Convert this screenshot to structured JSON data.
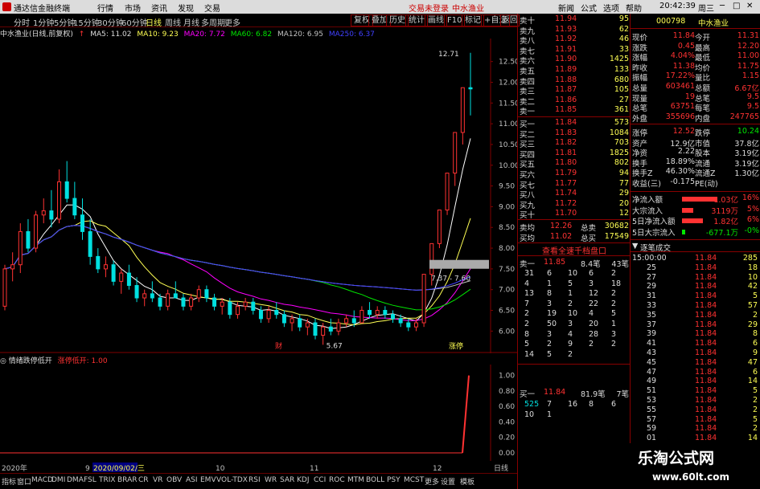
{
  "app": {
    "title": "通达信金融终端",
    "tabs": [
      "行情",
      "市场",
      "资讯",
      "发现",
      "交易"
    ],
    "login": "交易未登录",
    "stock_name": "中水渔业",
    "right_menu": [
      "新闻",
      "公式",
      "选项",
      "帮助"
    ],
    "time": "20:42:39",
    "weekday": "周三"
  },
  "toolbar": {
    "periods": [
      "分时",
      "1分钟",
      "5分钟",
      "15分钟",
      "30分钟",
      "60分钟",
      "日线",
      "周线",
      "月线",
      "多周期",
      "更多"
    ],
    "active_period": "日线",
    "buttons": [
      "复权",
      "叠加",
      "历史",
      "统计",
      "画线",
      "F10",
      "标记",
      "+自选",
      "返回"
    ]
  },
  "infobar": {
    "name": "中水渔业(日线,前复权)",
    "ma5": "MA5: 11.02",
    "ma10": "MA10: 9.23",
    "ma20": "MA20: 7.72",
    "ma60": "MA60: 6.82",
    "ma120": "MA120: 6.95",
    "ma250": "MA250: 6.37"
  },
  "colors": {
    "up": "#ff3232",
    "down": "#00e0e0",
    "ma5": "#ffffff",
    "ma10": "#ffff54",
    "ma20": "#ff00ff",
    "ma60": "#00e600",
    "ma120": "#c0c0c0",
    "ma250": "#4040ff",
    "grid": "#800000"
  },
  "chart_data": {
    "type": "candlestick",
    "y_ticks": [
      "12.50",
      "12.00",
      "11.50",
      "11.00",
      "10.50",
      "10.00",
      "9.50",
      "9.00",
      "8.50",
      "8.00",
      "7.50",
      "7.00",
      "6.50",
      "6.00"
    ],
    "ylim": [
      5.6,
      12.9
    ],
    "annotations": {
      "high": "12.71",
      "low": "5.67",
      "range_box": "7.37 - 7.60",
      "event1": "财",
      "event2": "涨停"
    },
    "candles": [
      [
        6.6,
        7.6,
        6.5,
        7.5
      ],
      [
        7.5,
        7.9,
        7.2,
        7.6
      ],
      [
        7.6,
        8.6,
        7.4,
        8.4
      ],
      [
        8.4,
        8.7,
        7.9,
        8.0
      ],
      [
        8.0,
        8.9,
        7.9,
        8.8
      ],
      [
        8.8,
        9.2,
        8.6,
        8.9
      ],
      [
        8.9,
        9.4,
        8.5,
        8.7
      ],
      [
        8.7,
        9.9,
        8.6,
        9.6
      ],
      [
        9.6,
        10.1,
        9.1,
        9.2
      ],
      [
        9.2,
        9.6,
        8.7,
        8.8
      ],
      [
        8.8,
        9.2,
        8.2,
        8.4
      ],
      [
        8.4,
        8.7,
        7.6,
        7.8
      ],
      [
        7.8,
        8.0,
        7.4,
        7.5
      ],
      [
        7.5,
        7.8,
        7.3,
        7.6
      ],
      [
        7.6,
        7.7,
        7.1,
        7.2
      ],
      [
        7.2,
        7.5,
        6.9,
        7.4
      ],
      [
        7.4,
        7.6,
        7.0,
        7.1
      ],
      [
        7.1,
        7.3,
        6.7,
        6.8
      ],
      [
        6.8,
        7.0,
        6.6,
        6.9
      ],
      [
        6.9,
        7.2,
        6.7,
        6.8
      ],
      [
        6.8,
        6.9,
        6.5,
        6.6
      ],
      [
        6.6,
        7.0,
        6.5,
        6.9
      ],
      [
        6.9,
        7.2,
        6.8,
        6.8
      ],
      [
        6.8,
        6.9,
        6.5,
        6.6
      ],
      [
        6.6,
        6.9,
        6.5,
        6.8
      ],
      [
        6.8,
        7.1,
        6.7,
        7.0
      ],
      [
        7.0,
        7.1,
        6.7,
        6.8
      ],
      [
        6.8,
        6.9,
        6.5,
        6.6
      ],
      [
        6.6,
        6.8,
        6.4,
        6.7
      ],
      [
        6.7,
        6.8,
        6.3,
        6.4
      ],
      [
        6.4,
        6.7,
        6.3,
        6.6
      ],
      [
        6.6,
        6.8,
        6.5,
        6.7
      ],
      [
        6.7,
        6.8,
        6.4,
        6.5
      ],
      [
        6.5,
        6.6,
        6.2,
        6.3
      ],
      [
        6.3,
        6.6,
        6.2,
        6.5
      ],
      [
        6.5,
        6.7,
        6.3,
        6.4
      ],
      [
        6.4,
        6.5,
        6.1,
        6.2
      ],
      [
        6.2,
        6.4,
        6.0,
        6.3
      ],
      [
        6.3,
        6.4,
        6.0,
        6.1
      ],
      [
        6.1,
        6.3,
        5.9,
        6.2
      ],
      [
        6.2,
        6.3,
        5.8,
        5.9
      ],
      [
        5.9,
        6.2,
        5.67,
        6.1
      ],
      [
        6.1,
        6.3,
        5.9,
        6.0
      ],
      [
        6.0,
        6.3,
        5.9,
        6.2
      ],
      [
        6.2,
        6.4,
        6.1,
        6.3
      ],
      [
        6.3,
        6.5,
        6.1,
        6.2
      ],
      [
        6.2,
        6.6,
        6.2,
        6.5
      ],
      [
        6.5,
        6.7,
        6.3,
        6.4
      ],
      [
        6.4,
        6.6,
        6.3,
        6.5
      ],
      [
        6.5,
        6.6,
        6.3,
        6.4
      ],
      [
        6.4,
        6.5,
        6.2,
        6.3
      ],
      [
        6.3,
        6.4,
        6.1,
        6.2
      ],
      [
        6.2,
        6.3,
        6.0,
        6.1
      ],
      [
        6.1,
        6.3,
        6.0,
        6.2
      ],
      [
        6.2,
        7.37,
        6.1,
        7.37
      ],
      [
        7.37,
        8.11,
        7.1,
        8.11
      ],
      [
        8.11,
        8.92,
        8.0,
        8.92
      ],
      [
        8.92,
        9.81,
        8.8,
        9.81
      ],
      [
        9.81,
        10.79,
        9.5,
        10.79
      ],
      [
        10.79,
        11.87,
        10.5,
        11.87
      ],
      [
        11.87,
        12.71,
        11.2,
        11.84
      ]
    ],
    "indicator": {
      "title": "情绪跌停低开",
      "label": "涨停低开: 1.00",
      "y_ticks": [
        "1.00",
        "0.80",
        "0.60",
        "0.40",
        "0.20",
        "0.00"
      ],
      "ylim": [
        0,
        1.1
      ],
      "values_last": 1.0
    },
    "dates": {
      "start": "2020年",
      "month9": "9",
      "date": "2020/09/02/三",
      "month10": "10",
      "month11": "11",
      "month12": "12"
    }
  },
  "bottomtabs": [
    "指标",
    "窗口",
    "MACD",
    "DMI",
    "DMA",
    "FSL",
    "TRIX",
    "BRAR",
    "CR",
    "VR",
    "OBV",
    "ASI",
    "EMV",
    "VOL-TDX",
    "RSI",
    "WR",
    "SAR",
    "KDJ",
    "CCI",
    "ROC",
    "MTM",
    "BOLL",
    "PSY",
    "MCST",
    "更多",
    "设置",
    "模板"
  ],
  "order_book": {
    "sell": [
      [
        "卖十",
        "11.94",
        "95"
      ],
      [
        "卖九",
        "11.93",
        "62"
      ],
      [
        "卖八",
        "11.92",
        "46"
      ],
      [
        "卖七",
        "11.91",
        "33"
      ],
      [
        "卖六",
        "11.90",
        "1425"
      ],
      [
        "卖五",
        "11.89",
        "133"
      ],
      [
        "卖四",
        "11.88",
        "680"
      ],
      [
        "卖三",
        "11.87",
        "105"
      ],
      [
        "卖二",
        "11.86",
        "27"
      ],
      [
        "卖一",
        "11.85",
        "361"
      ]
    ],
    "buy": [
      [
        "买一",
        "11.84",
        "573"
      ],
      [
        "买二",
        "11.83",
        "1084"
      ],
      [
        "买三",
        "11.82",
        "703"
      ],
      [
        "买四",
        "11.81",
        "1825"
      ],
      [
        "买五",
        "11.80",
        "802"
      ],
      [
        "买六",
        "11.79",
        "94"
      ],
      [
        "买七",
        "11.77",
        "77"
      ],
      [
        "买八",
        "11.74",
        "29"
      ],
      [
        "买九",
        "11.72",
        "20"
      ],
      [
        "买十",
        "11.70",
        "12"
      ]
    ],
    "avg_sell": [
      "卖均",
      "12.26",
      "总卖",
      "30682"
    ],
    "avg_buy": [
      "买均",
      "11.02",
      "总买",
      "17549"
    ],
    "link": "查看全速千档盘口",
    "sell_queue_head": [
      "卖一",
      "11.85",
      "8.4笔",
      "43笔"
    ],
    "sell_queue": [
      [
        "31",
        "6",
        "10",
        "6",
        "2"
      ],
      [
        "4",
        "1",
        "5",
        "3",
        "18"
      ],
      [
        "13",
        "8",
        "1",
        "12",
        "2"
      ],
      [
        "7",
        "3",
        "2",
        "22",
        "2"
      ],
      [
        "2",
        "19",
        "10",
        "4",
        "5"
      ],
      [
        "2",
        "50",
        "3",
        "20",
        "1"
      ],
      [
        "8",
        "3",
        "4",
        "28",
        "3"
      ],
      [
        "5",
        "2",
        "9",
        "2",
        "2"
      ],
      [
        "14",
        "5",
        "2",
        "",
        ""
      ]
    ],
    "buy_queue_head": [
      "买一",
      "11.84",
      "81.9笔",
      "7笔"
    ],
    "buy_queue": [
      [
        "525",
        "7",
        "16",
        "8",
        "6"
      ],
      [
        "10",
        "1",
        "",
        "",
        ""
      ]
    ]
  },
  "stats": {
    "code": "000798",
    "name": "中水渔业",
    "rows": [
      [
        "现价",
        "11.84",
        "今开",
        "11.31"
      ],
      [
        "涨跌",
        "0.45",
        "最高",
        "12.20"
      ],
      [
        "涨幅",
        "4.04%",
        "最低",
        "11.00"
      ],
      [
        "昨收",
        "11.38",
        "均价",
        "11.75"
      ],
      [
        "振幅",
        "17.22%",
        "量比",
        "1.15"
      ],
      [
        "总量",
        "603461",
        "总额",
        "6.67亿"
      ],
      [
        "现量",
        "19",
        "总笔",
        "9.5"
      ],
      [
        "总笔",
        "63751",
        "每笔",
        "9.5"
      ],
      [
        "外盘",
        "355696",
        "内盘",
        "247765"
      ]
    ],
    "rows2": [
      [
        "涨停",
        "12.52",
        "跌停",
        "10.24"
      ],
      [
        "资产",
        "12.9亿",
        "市值",
        "37.8亿"
      ],
      [
        "净资",
        "2.22",
        "股本",
        "3.19亿"
      ],
      [
        "换手",
        "18.89%",
        "流通",
        "3.19亿"
      ],
      [
        "换手Z",
        "46.30%",
        "流通Z",
        "1.30亿"
      ],
      [
        "收益(三)",
        "-0.175",
        "PE(动)",
        ""
      ]
    ],
    "flows": [
      [
        "净流入额",
        "1.03亿",
        "16%"
      ],
      [
        "大宗流入",
        "3119万",
        "5%"
      ],
      [
        "5日净流入额",
        "1.82亿",
        "6%"
      ],
      [
        "5日大宗流入",
        "-677.1万",
        "-0%"
      ]
    ],
    "tick_title": "逐笔成交",
    "ticks": [
      [
        "15:00:00",
        "11.84",
        "285"
      ],
      [
        "25",
        "11.84",
        "18"
      ],
      [
        "27",
        "11.84",
        "10"
      ],
      [
        "29",
        "11.84",
        "42"
      ],
      [
        "31",
        "11.84",
        "5"
      ],
      [
        "33",
        "11.84",
        "57"
      ],
      [
        "35",
        "11.84",
        "2"
      ],
      [
        "37",
        "11.84",
        "29"
      ],
      [
        "39",
        "11.84",
        "8"
      ],
      [
        "41",
        "11.84",
        "6"
      ],
      [
        "43",
        "11.84",
        "9"
      ],
      [
        "45",
        "11.84",
        "47"
      ],
      [
        "47",
        "11.84",
        "6"
      ],
      [
        "49",
        "11.84",
        "14"
      ],
      [
        "51",
        "11.84",
        "5"
      ],
      [
        "53",
        "11.84",
        "2"
      ],
      [
        "55",
        "11.84",
        "2"
      ],
      [
        "57",
        "11.84",
        "5"
      ],
      [
        "59",
        "11.84",
        "2"
      ],
      [
        "01",
        "11.84",
        "14"
      ]
    ]
  },
  "watermark": {
    "line1": "乐淘公式网",
    "line2": "www.60lt.com"
  }
}
